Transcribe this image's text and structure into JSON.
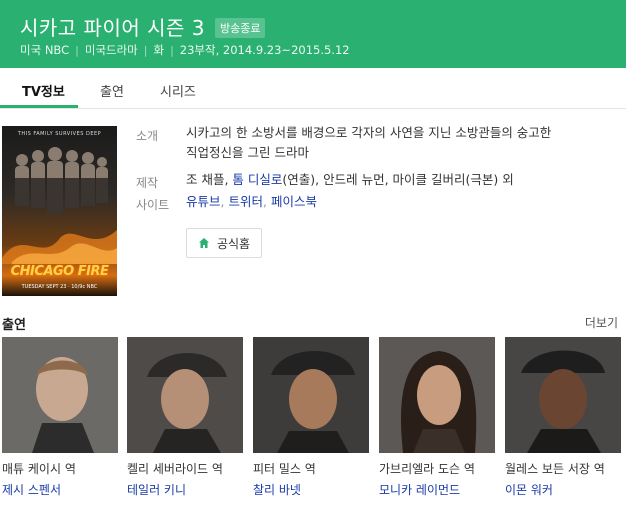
{
  "header": {
    "title": "시카고 파이어 시즌 3",
    "badge": "방송종료",
    "meta": [
      "미국 NBC",
      "미국드라마",
      "화",
      "23부작, 2014.9.23~2015.5.12"
    ],
    "bg_color": "#2ab171"
  },
  "tabs": [
    "TV정보",
    "출연",
    "시리즈"
  ],
  "poster": {
    "tagline": "THIS FAMILY SURVIVES DEEP",
    "logo": "CHICAGO FIRE",
    "date": "TUESDAY SEPT 23 · 10/9c NBC"
  },
  "info": {
    "summary_label": "소개",
    "summary_line1": "시카고의 한 소방서를 배경으로 각자의 사연을 지닌 소방관들의 숭고한",
    "summary_line2": "직업정신을 그린 드라마",
    "production_label": "제작",
    "production_prefix": "조 채플, ",
    "production_link": "톰 디실로",
    "production_mid": "(연출), 안드레 뉴먼, 마이클 길버리(극본) 외",
    "site_label": "사이트",
    "sites": [
      "유튜브",
      "트위터",
      "페이스북"
    ],
    "homepage_label": "공식홈"
  },
  "cast_section": {
    "title": "출연",
    "more": "더보기",
    "members": [
      {
        "role": "매튜 케이시 역",
        "actor": "제시 스펜서"
      },
      {
        "role": "켈리 세버라이드 역",
        "actor": "테일러 키니"
      },
      {
        "role": "피터 밀스 역",
        "actor": "찰리 바넷"
      },
      {
        "role": "가브리엘라 도슨 역",
        "actor": "모니카 레이먼드"
      },
      {
        "role": "월레스 보든 서장 역",
        "actor": "이몬 워커"
      }
    ]
  }
}
